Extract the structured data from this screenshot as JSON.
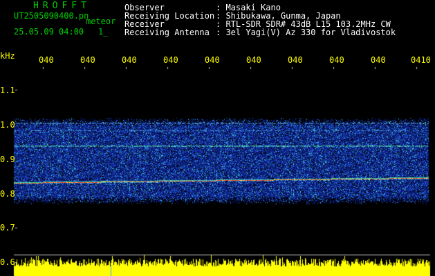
{
  "header": {
    "app_title": "HROFFT",
    "filename": "UT2505090400.pn",
    "meteor_label": "meteor",
    "datetime": "25.05.09 04:00",
    "count": "1_",
    "fields": [
      {
        "label": "Observer",
        "value": ": Masaki Kano"
      },
      {
        "label": "Receiving Location",
        "value": ": Shibukawa, Gunma, Japan"
      },
      {
        "label": "Receiver",
        "value": ": RTL-SDR SDR# 43dB L15 103.2MHz CW"
      },
      {
        "label": "Receiving Antenna",
        "value": ": 3el Yagi(V) Az 330 for Vladivostok"
      }
    ]
  },
  "time_axis": {
    "ticks": [
      "040",
      "040",
      "040",
      "040",
      "040",
      "040",
      "040",
      "040",
      "040",
      "0410"
    ]
  },
  "freq_axis": {
    "unit": "kHz",
    "ticks": [
      "1.1",
      "1.0",
      "0.9",
      "0.8",
      "0.7",
      "0.6"
    ]
  },
  "colors": {
    "title": "#00d000",
    "tick_label": "#ffff00",
    "signal_strong": "#ff3030",
    "band_noise": "#1830a0",
    "meter": "#ffff00"
  }
}
